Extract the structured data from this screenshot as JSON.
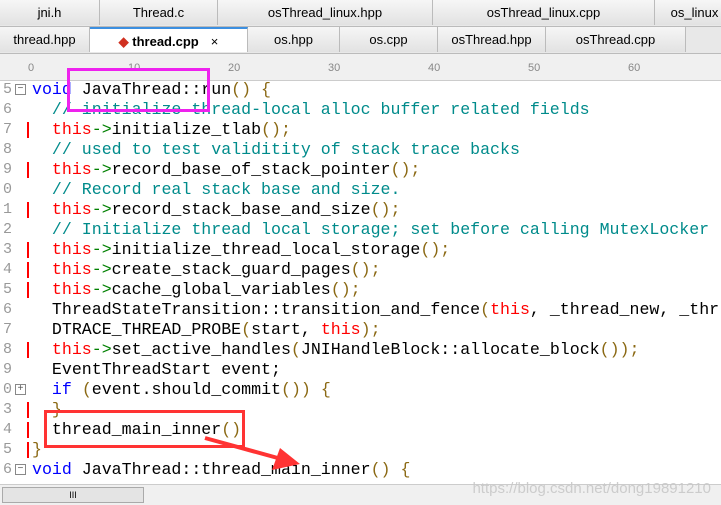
{
  "tabs_row1": [
    "jni.h",
    "Thread.c",
    "osThread_linux.hpp",
    "osThread_linux.cpp",
    "os_linux"
  ],
  "tabs_row2": [
    "thread.hpp",
    "thread.cpp",
    "os.hpp",
    "os.cpp",
    "osThread.hpp",
    "osThread.cpp"
  ],
  "active_tab": "thread.cpp",
  "close_glyph": "×",
  "ruler": [
    "0",
    "10",
    "20",
    "30",
    "40",
    "50",
    "60"
  ],
  "line_numbers": [
    "5",
    "6",
    "7",
    "8",
    "9",
    "0",
    "1",
    "2",
    "3",
    "4",
    "5",
    "6",
    "7",
    "8",
    "9",
    "0",
    "3",
    "4",
    "5",
    "6"
  ],
  "lines": [
    [
      [
        "kw",
        "void"
      ],
      [
        "t",
        " JavaThread::run"
      ],
      [
        "p",
        "()"
      ],
      [
        "p",
        " {"
      ]
    ],
    [
      [
        "cm",
        "  // initialize thread-local alloc buffer related fields"
      ]
    ],
    [
      [
        "th",
        "  this"
      ],
      [
        "ar",
        "->"
      ],
      [
        "t",
        "initialize_tlab"
      ],
      [
        "p",
        "();"
      ]
    ],
    [
      [
        "cm",
        "  // used to test validitity of stack trace backs"
      ]
    ],
    [
      [
        "th",
        "  this"
      ],
      [
        "ar",
        "->"
      ],
      [
        "t",
        "record_base_of_stack_pointer"
      ],
      [
        "p",
        "();"
      ]
    ],
    [
      [
        "cm",
        "  // Record real stack base and size."
      ]
    ],
    [
      [
        "th",
        "  this"
      ],
      [
        "ar",
        "->"
      ],
      [
        "t",
        "record_stack_base_and_size"
      ],
      [
        "p",
        "();"
      ]
    ],
    [
      [
        "cm",
        "  // Initialize thread local storage; set before calling MutexLocker"
      ]
    ],
    [
      [
        "th",
        "  this"
      ],
      [
        "ar",
        "->"
      ],
      [
        "t",
        "initialize_thread_local_storage"
      ],
      [
        "p",
        "();"
      ]
    ],
    [
      [
        "th",
        "  this"
      ],
      [
        "ar",
        "->"
      ],
      [
        "t",
        "create_stack_guard_pages"
      ],
      [
        "p",
        "();"
      ]
    ],
    [
      [
        "th",
        "  this"
      ],
      [
        "ar",
        "->"
      ],
      [
        "t",
        "cache_global_variables"
      ],
      [
        "p",
        "();"
      ]
    ],
    [
      [
        "t",
        "  ThreadStateTransition::transition_and_fence"
      ],
      [
        "p",
        "("
      ],
      [
        "th",
        "this"
      ],
      [
        "t",
        ", _thread_new, _thr"
      ]
    ],
    [
      [
        "t",
        "  DTRACE_THREAD_PROBE"
      ],
      [
        "p",
        "("
      ],
      [
        "t",
        "start, "
      ],
      [
        "th",
        "this"
      ],
      [
        "p",
        ");"
      ]
    ],
    [
      [
        "th",
        "  this"
      ],
      [
        "ar",
        "->"
      ],
      [
        "t",
        "set_active_handles"
      ],
      [
        "p",
        "("
      ],
      [
        "t",
        "JNIHandleBlock::allocate_block"
      ],
      [
        "p",
        "());"
      ]
    ],
    [
      [
        "t",
        "  EventThreadStart event;"
      ]
    ],
    [
      [
        "kw",
        "  if"
      ],
      [
        "t",
        " "
      ],
      [
        "p",
        "("
      ],
      [
        "t",
        "event.should_commit"
      ],
      [
        "p",
        "()) {"
      ]
    ],
    [
      [
        "p",
        "  }"
      ]
    ],
    [
      [
        "t",
        "  thread_main_inner"
      ],
      [
        "p",
        "()"
      ]
    ],
    [
      [
        "p",
        "}"
      ]
    ],
    [
      [
        "kw",
        "void"
      ],
      [
        "t",
        " JavaThread::thread_main_inner"
      ],
      [
        "p",
        "() {"
      ]
    ]
  ],
  "scroll_thumb": "III",
  "watermark": "https://blog.csdn.net/dong19891210",
  "colors": {
    "highlight_magenta": "#ee22ee",
    "highlight_red": "#ff3333",
    "active_tab_accent": "#3c8fe0"
  }
}
